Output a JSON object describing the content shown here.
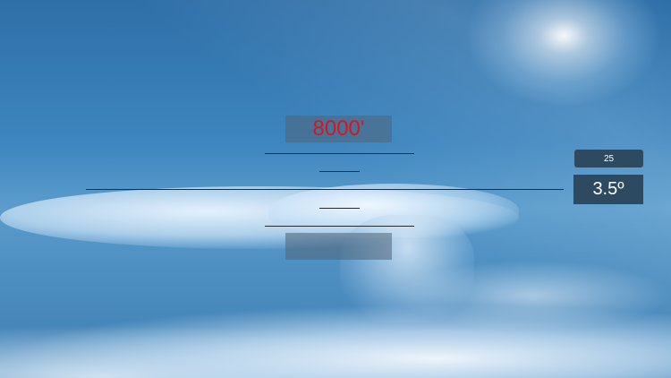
{
  "altitude": {
    "value": "8000'",
    "color": "#d8141d"
  },
  "lower_readout": {
    "value": ""
  },
  "small_readout": {
    "value": "25"
  },
  "angle_readout": {
    "value": "3.5º"
  },
  "colors": {
    "readout_bg": "#2e4a61",
    "line": "#2a2a2a"
  }
}
